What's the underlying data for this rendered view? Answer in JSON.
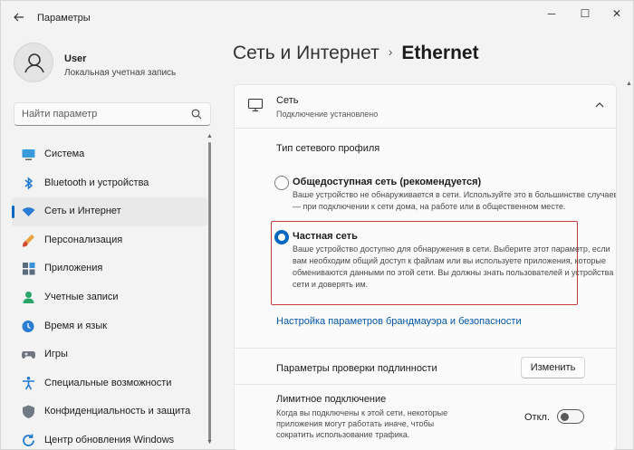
{
  "window": {
    "title": "Параметры",
    "back_icon": "arrow-left-icon",
    "controls": {
      "minimize": "─",
      "maximize": "☐",
      "close": "✕"
    }
  },
  "user": {
    "name": "User",
    "account_type": "Локальная учетная запись"
  },
  "search": {
    "placeholder": "Найти параметр"
  },
  "sidebar": {
    "items": [
      {
        "label": "Система",
        "icon": "monitor-icon",
        "active": false
      },
      {
        "label": "Bluetooth и устройства",
        "icon": "bluetooth-icon",
        "active": false
      },
      {
        "label": "Сеть и Интернет",
        "icon": "wifi-icon",
        "active": true
      },
      {
        "label": "Персонализация",
        "icon": "brush-icon",
        "active": false
      },
      {
        "label": "Приложения",
        "icon": "apps-icon",
        "active": false
      },
      {
        "label": "Учетные записи",
        "icon": "person-icon",
        "active": false
      },
      {
        "label": "Время и язык",
        "icon": "globe-clock-icon",
        "active": false
      },
      {
        "label": "Игры",
        "icon": "gamepad-icon",
        "active": false
      },
      {
        "label": "Специальные возможности",
        "icon": "accessibility-icon",
        "active": false
      },
      {
        "label": "Конфиденциальность и защита",
        "icon": "shield-icon",
        "active": false
      },
      {
        "label": "Центр обновления Windows",
        "icon": "refresh-icon",
        "active": false
      }
    ]
  },
  "breadcrumb": {
    "parent": "Сеть и Интернет",
    "separator": "›",
    "current": "Ethernet"
  },
  "network_panel": {
    "title": "Сеть",
    "status": "Подключение установлено",
    "profile_type_label": "Тип сетевого профиля",
    "options": {
      "public": {
        "title": "Общедоступная сеть (рекомендуется)",
        "description": "Ваше устройство не обнаруживается в сети. Используйте это в большинстве случаев — при подключении к сети дома, на работе или в общественном месте.",
        "selected": false
      },
      "private": {
        "title": "Частная сеть",
        "description": "Ваше устройство доступно для обнаружения в сети. Выберите этот параметр, если вам необходим общий доступ к файлам или вы используете приложения, которые обмениваются данными по этой сети. Вы должны знать пользователей и устройства в сети и доверять им.",
        "selected": true
      }
    },
    "firewall_link": "Настройка параметров брандмауэра и безопасности",
    "auth_settings_label": "Параметры проверки подлинности",
    "change_button": "Изменить",
    "metered": {
      "label": "Лимитное подключение",
      "description": "Когда вы подключены к этой сети, некоторые приложения могут работать иначе, чтобы сократить использование трафика.",
      "state_label": "Откл.",
      "enabled": false
    }
  },
  "colors": {
    "accent": "#0067c0",
    "highlight_border": "#c43b3b",
    "link": "#0055a8"
  }
}
